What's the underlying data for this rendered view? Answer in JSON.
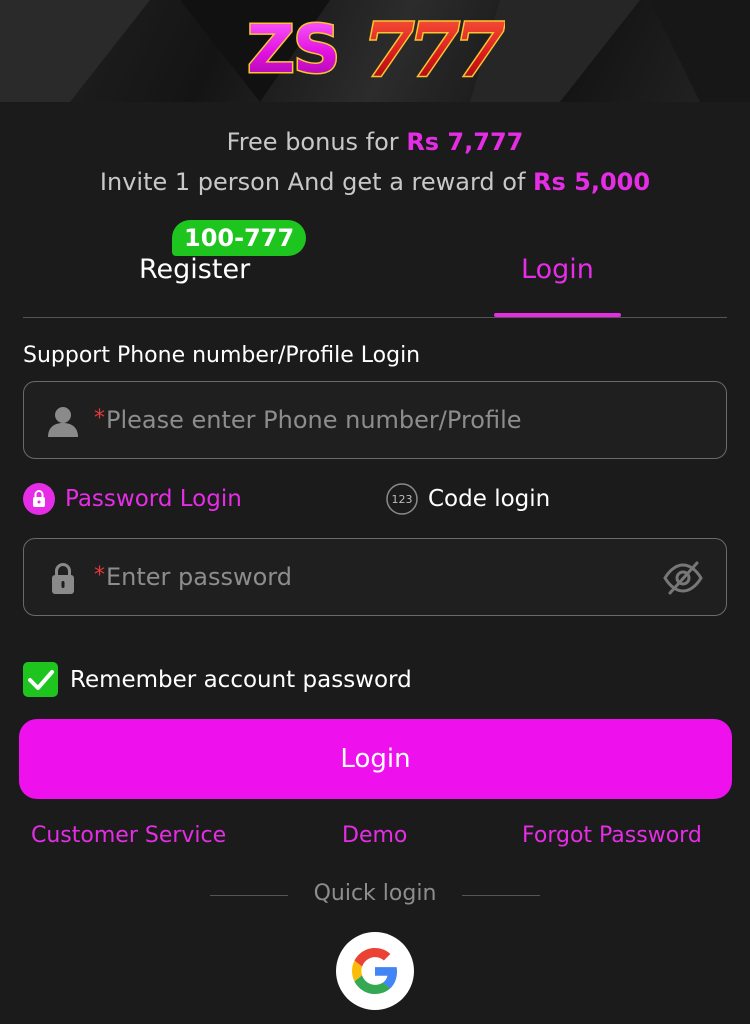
{
  "brand": {
    "logo_text": "ZS777"
  },
  "bonus": {
    "line1_prefix": "Free bonus for ",
    "line1_amount": "Rs 7,777",
    "line2_prefix": "Invite 1 person And get a reward of ",
    "line2_amount": "Rs 5,000"
  },
  "tabs": {
    "register_label": "Register",
    "register_badge": "100-777",
    "login_label": "Login",
    "active": "Login"
  },
  "form": {
    "support_label": "Support Phone number/Profile Login",
    "phone_required_mark": "*",
    "phone_placeholder": "Please enter Phone number/Profile",
    "password_required_mark": "*",
    "password_placeholder": "Enter password",
    "mode_password_label": "Password Login",
    "mode_code_label": "Code login",
    "mode_code_icon_text": "123",
    "active_mode": "Password Login",
    "remember_label": "Remember account password",
    "remember_checked": true,
    "submit_label": "Login"
  },
  "links": {
    "customer_service": "Customer Service",
    "demo": "Demo",
    "forgot_password": "Forgot Password"
  },
  "quick_login": {
    "label": "Quick login",
    "providers": [
      "google-icon"
    ]
  },
  "icons": {
    "phone_field": "user-icon",
    "password_field": "lock-icon",
    "password_toggle": "eye-off-icon",
    "mode_password": "lock-circle-icon",
    "mode_code": "code-123-icon",
    "remember": "checkmark-icon"
  },
  "colors": {
    "accent": "#e52de5",
    "button": "#ee11ee",
    "success": "#1ec51e",
    "background": "#1b1b1b"
  }
}
